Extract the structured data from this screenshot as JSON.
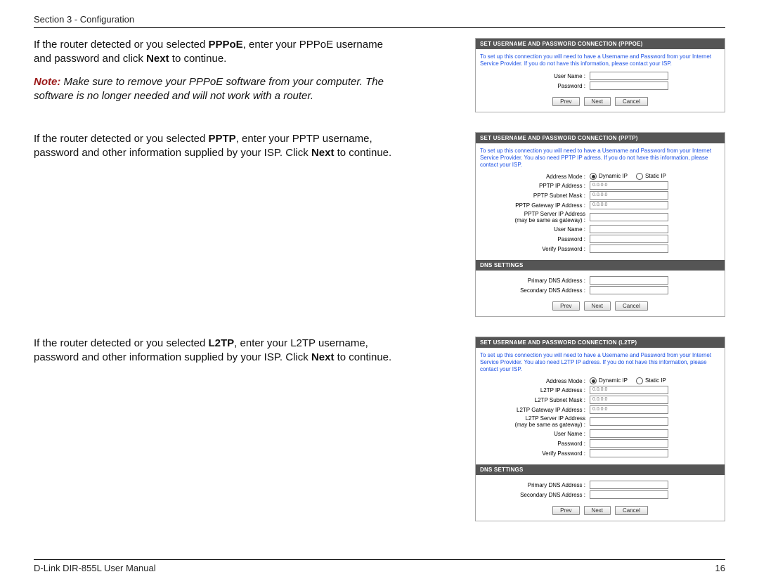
{
  "header": "Section 3 - Configuration",
  "footer_left": "D-Link DIR-855L User Manual",
  "footer_page": "16",
  "blocks": [
    {
      "text_html": "If the router detected or you selected <b>PPPoE</b>, enter your PPPoE username and password and click <b>Next</b> to continue.",
      "note_html": "Make sure to remove your PPPoE software from your computer. The software is no longer needed and will not work with a router.",
      "panel": {
        "title": "SET USERNAME AND PASSWORD CONNECTION (PPPOE)",
        "desc": "To set up this connection you will need to have a Username and Password from your Internet Service Provider. If you do not have this information, please contact your ISP.",
        "fields": [
          {
            "label": "User Name :",
            "value": ""
          },
          {
            "label": "Password :",
            "value": ""
          }
        ],
        "buttons": [
          "Prev",
          "Next",
          "Cancel"
        ]
      }
    },
    {
      "text_html": "If the router detected or you selected <b>PPTP</b>, enter your PPTP username, password and other information supplied by your ISP. Click <b>Next</b> to continue.",
      "panel": {
        "title": "SET USERNAME AND PASSWORD CONNECTION (PPTP)",
        "desc": "To set up this connection you will need to have a Username and Password from your Internet Service Provider. You also need PPTP IP adress. If you do not have this information, please contact your ISP.",
        "address_mode": {
          "label": "Address Mode :",
          "options": [
            "Dynamic IP",
            "Static IP"
          ],
          "selected": 0
        },
        "fields": [
          {
            "label": "PPTP IP Address :",
            "value": "0.0.0.0"
          },
          {
            "label": "PPTP Subnet Mask :",
            "value": "0.0.0.0"
          },
          {
            "label": "PPTP Gateway IP Address :",
            "value": "0.0.0.0"
          },
          {
            "label": "PPTP Server IP Address\n(may be same as gateway) :",
            "value": ""
          },
          {
            "label": "User Name :",
            "value": ""
          },
          {
            "label": "Password :",
            "value": ""
          },
          {
            "label": "Verify Password :",
            "value": ""
          }
        ],
        "dns_title": "DNS SETTINGS",
        "dns_fields": [
          {
            "label": "Primary DNS Address :",
            "value": ""
          },
          {
            "label": "Secondary DNS Address :",
            "value": ""
          }
        ],
        "buttons": [
          "Prev",
          "Next",
          "Cancel"
        ]
      }
    },
    {
      "text_html": "If the router detected or you selected <b>L2TP</b>, enter your L2TP username, password and other information supplied by your ISP. Click <b>Next</b> to continue.",
      "panel": {
        "title": "SET USERNAME AND PASSWORD CONNECTION (L2TP)",
        "desc": "To set up this connection you will need to have a Username and Password from your Internet Service Provider. You also need L2TP IP adress. If you do not have this information, please contact your ISP.",
        "address_mode": {
          "label": "Address Mode :",
          "options": [
            "Dynamic IP",
            "Static IP"
          ],
          "selected": 0
        },
        "fields": [
          {
            "label": "L2TP IP Address :",
            "value": "0.0.0.0"
          },
          {
            "label": "L2TP Subnet Mask :",
            "value": "0.0.0.0"
          },
          {
            "label": "L2TP Gateway IP Address :",
            "value": "0.0.0.0"
          },
          {
            "label": "L2TP Server IP Address\n(may be same as gateway) :",
            "value": ""
          },
          {
            "label": "User Name :",
            "value": ""
          },
          {
            "label": "Password :",
            "value": ""
          },
          {
            "label": "Verify Password :",
            "value": ""
          }
        ],
        "dns_title": "DNS SETTINGS",
        "dns_fields": [
          {
            "label": "Primary DNS Address :",
            "value": ""
          },
          {
            "label": "Secondary DNS Address :",
            "value": ""
          }
        ],
        "buttons": [
          "Prev",
          "Next",
          "Cancel"
        ]
      }
    }
  ],
  "note_label": "Note:"
}
